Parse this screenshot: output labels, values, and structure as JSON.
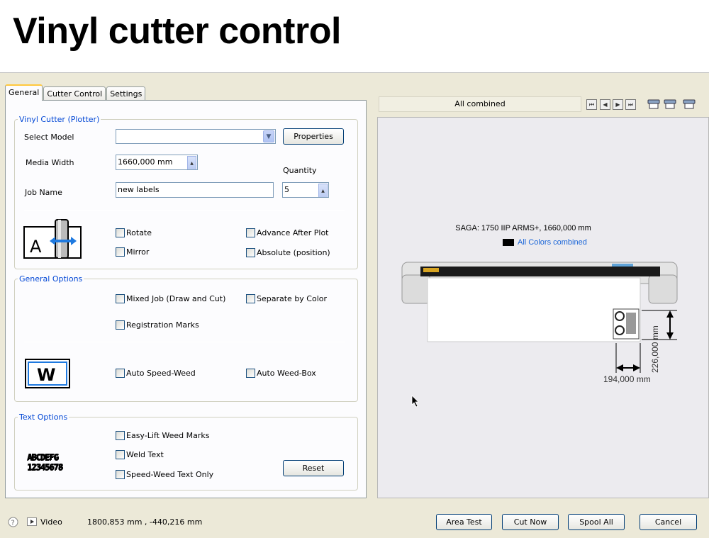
{
  "slide": {
    "title": "Vinyl cutter control"
  },
  "tabs": [
    {
      "label": "General",
      "active": true
    },
    {
      "label": "Cutter Control",
      "active": false
    },
    {
      "label": "Settings",
      "active": false
    }
  ],
  "vinyl_group": {
    "legend": "Vinyl Cutter (Plotter)",
    "select_model_label": "Select Model",
    "select_model_value": "",
    "properties_button": "Properties",
    "media_width_label": "Media Width",
    "media_width_value": "1660,000 mm",
    "quantity_label": "Quantity",
    "quantity_value": "5",
    "job_name_label": "Job Name",
    "job_name_value": "new labels",
    "rotate": "Rotate",
    "mirror": "Mirror",
    "advance_after_plot": "Advance After Plot",
    "absolute_position": "Absolute (position)",
    "icon_letter": "A"
  },
  "general_options": {
    "legend": "General Options",
    "mixed_job": "Mixed Job (Draw and Cut)",
    "separate_by_color": "Separate by Color",
    "registration_marks": "Registration Marks",
    "auto_speed_weed": "Auto Speed-Weed",
    "auto_weed_box": "Auto Weed-Box",
    "icon_letter": "W"
  },
  "text_options": {
    "legend": "Text Options",
    "easy_lift": "Easy-Lift Weed Marks",
    "weld_text": "Weld Text",
    "speed_weed_text": "Speed-Weed Text Only",
    "reset_button": "Reset",
    "sample_line1": "ABCDEFG",
    "sample_line2": "12345678"
  },
  "preview": {
    "selector": "All combined",
    "machine": "SAGA: 1750 IIP ARMS+, 1660,000 mm",
    "colors_legend": "All Colors combined",
    "height_dim": "226,000 mm",
    "width_dim": "194,000 mm"
  },
  "status_bar": {
    "video_label": "Video",
    "coordinates": "1800,853 mm , -440,216 mm",
    "area_test": "Area Test",
    "cut_now": "Cut Now",
    "spool_all": "Spool All",
    "cancel": "Cancel"
  },
  "colors": {
    "legend_blue": "#0046d5",
    "link_blue": "#1b66d8"
  },
  "icons": [
    "help-icon",
    "play-icon",
    "first-page-icon",
    "prev-page-icon",
    "next-page-icon",
    "last-page-icon",
    "view-icon",
    "rotate-icon",
    "weed-icon",
    "text-icon",
    "cursor-icon"
  ]
}
